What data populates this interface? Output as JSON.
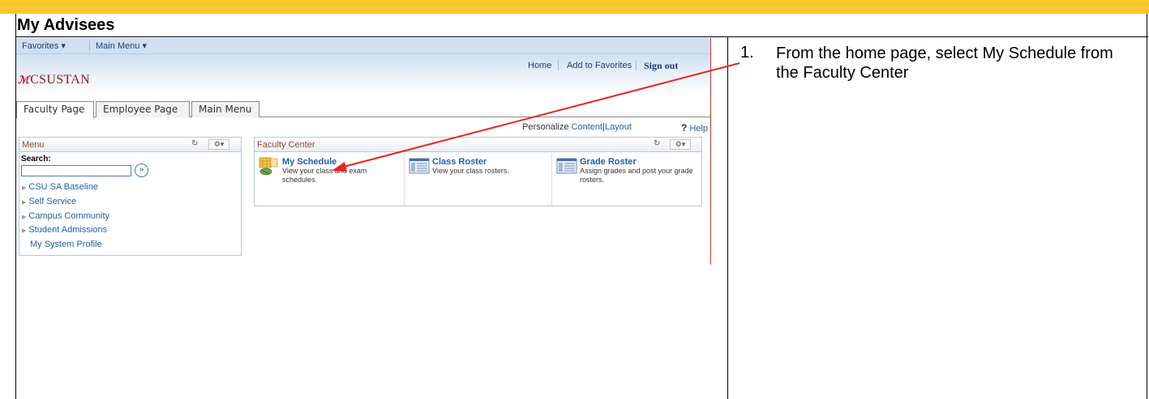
{
  "document": {
    "title": "My Advisees",
    "step_number": "1.",
    "step_text": "From the home page, select My Schedule from the Faculty Center"
  },
  "screenshot": {
    "favorites_label": "Favorites",
    "main_menu_label": "Main Menu",
    "header_links": {
      "home": "Home",
      "add_to_favorites": "Add to Favorites",
      "sign_out": "Sign out"
    },
    "logo_text": "CSUSTAN",
    "tabs": [
      {
        "label": "Faculty Page"
      },
      {
        "label": "Employee Page"
      },
      {
        "label": "Main Menu"
      }
    ],
    "personalize": {
      "prefix": "Personalize",
      "content": "Content",
      "separator": "|",
      "layout": "Layout"
    },
    "help_label": "Help",
    "menu_pagelet": {
      "title": "Menu",
      "search_label": "Search:",
      "items": [
        {
          "label": "CSU SA Baseline"
        },
        {
          "label": "Self Service"
        },
        {
          "label": "Campus Community"
        },
        {
          "label": "Student Admissions"
        },
        {
          "label": "My System Profile"
        }
      ]
    },
    "faculty_center": {
      "title": "Faculty Center",
      "items": [
        {
          "label": "My Schedule",
          "description": "View your class and exam schedules.",
          "icon": "schedule-icon"
        },
        {
          "label": "Class Roster",
          "description": "View your class rosters.",
          "icon": "roster-icon"
        },
        {
          "label": "Grade Roster",
          "description": "Assign grades and post your grade rosters.",
          "icon": "grade-roster-icon"
        }
      ]
    }
  },
  "colors": {
    "gold_bar": "#ffc82a",
    "annotation_arrow": "#e8261c",
    "link_blue": "#1f5fa8"
  }
}
